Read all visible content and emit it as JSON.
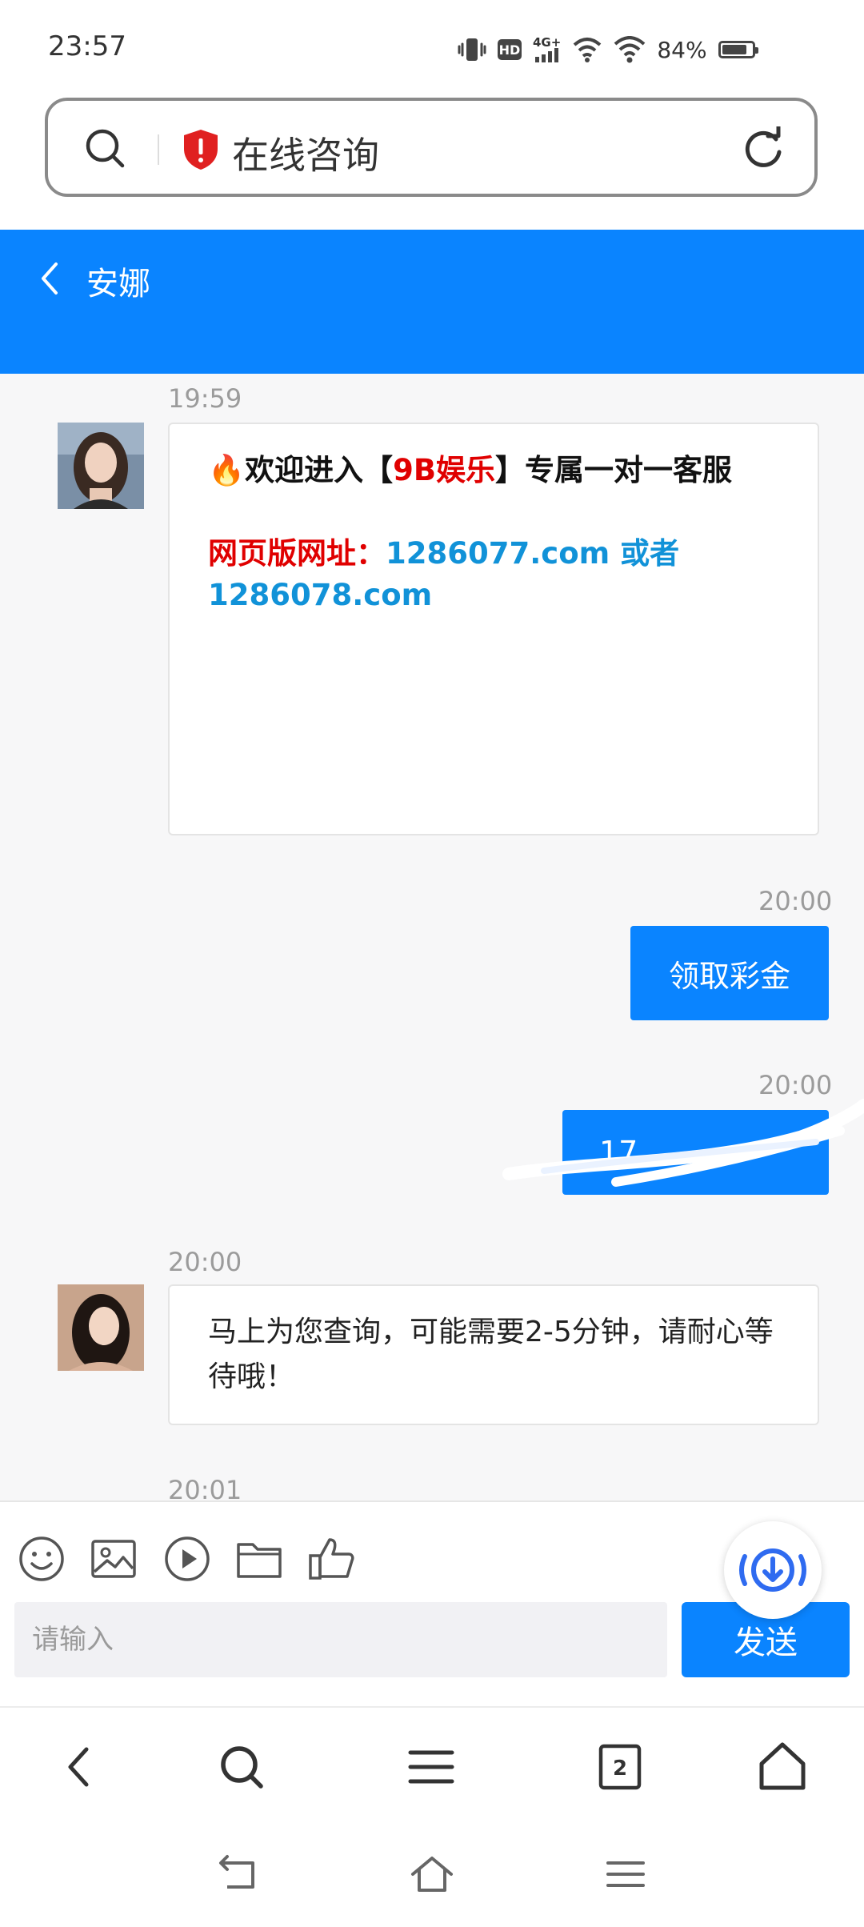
{
  "status_bar": {
    "time": "23:57",
    "network": "4G+",
    "hd_badge": "HD",
    "battery_percent": "84%",
    "battery_level": 0.84
  },
  "address_bar": {
    "title": "在线咨询",
    "icons": [
      "search-icon",
      "security-shield-icon",
      "reload-icon"
    ]
  },
  "chat_header": {
    "title": "安娜",
    "back_icon": "chevron-left-icon"
  },
  "messages": [
    {
      "side": "in",
      "time": "19:59",
      "welcome_prefix": "🔥欢迎进入【",
      "welcome_brand": "9B娱乐",
      "welcome_suffix": "】专属一对一客服",
      "url_label": "网页版网址：",
      "url_1": "1286077.com",
      "url_or": " 或者",
      "url_2": "1286078.com"
    },
    {
      "side": "out",
      "time": "20:00",
      "text": "领取彩金"
    },
    {
      "side": "out",
      "time": "20:00",
      "text": "17"
    },
    {
      "side": "in",
      "time": "20:00",
      "text": "马上为您查询，可能需要2-5分钟，请耐心等待哦！"
    },
    {
      "side": "in",
      "time": "20:01"
    }
  ],
  "input_area": {
    "toolbar_icons": [
      "emoji-icon",
      "image-icon",
      "video-icon",
      "folder-icon",
      "thumbs-up-icon"
    ],
    "placeholder": "请输入",
    "send_label": "发送"
  },
  "browser_nav": {
    "tab_count": "2",
    "icons": [
      "back-icon",
      "search-icon",
      "menu-icon",
      "tabs-icon",
      "home-icon"
    ]
  },
  "colors": {
    "accent": "#0a84ff",
    "brand_red": "#e00000",
    "link_blue": "#1192d8",
    "chat_bg": "#f7f7f8"
  }
}
